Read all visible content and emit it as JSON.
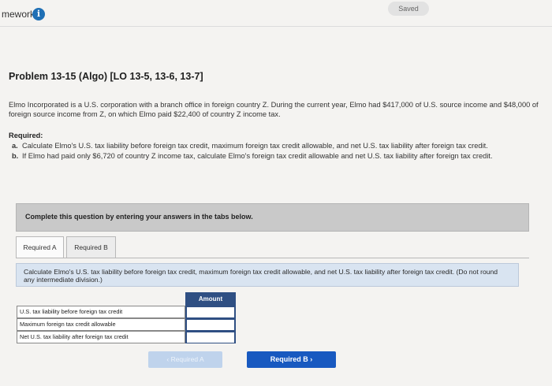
{
  "header": {
    "title": "mework",
    "info_icon": "info-icon",
    "saved_label": "Saved"
  },
  "problem": {
    "title": "Problem 13-15 (Algo) [LO 13-5, 13-6, 13-7]",
    "intro": "Elmo Incorporated is a U.S. corporation with a branch office in foreign country Z. During the current year, Elmo had $417,000 of U.S. source income and $48,000 of foreign source income from Z, on which Elmo paid $22,400 of country Z income tax.",
    "required_heading": "Required:",
    "requirements": [
      {
        "tag": "a.",
        "text": "Calculate Elmo's U.S. tax liability before foreign tax credit, maximum foreign tax credit allowable, and net U.S. tax liability after foreign tax credit."
      },
      {
        "tag": "b.",
        "text": "If Elmo had paid only $6,720 of country Z income tax, calculate Elmo's foreign tax credit allowable and net U.S. tax liability after foreign tax credit."
      }
    ]
  },
  "instruction": "Complete this question by entering your answers in the tabs below.",
  "tabs": [
    {
      "label": "Required A"
    },
    {
      "label": "Required B"
    }
  ],
  "question": "Calculate Elmo's U.S. tax liability before foreign tax credit, maximum foreign tax credit allowable, and net U.S. tax liability after foreign tax credit. (Do not round any intermediate division.)",
  "table": {
    "amount_header": "Amount",
    "rows": [
      {
        "label": "U.S. tax liability before foreign tax credit",
        "value": ""
      },
      {
        "label": "Maximum foreign tax credit allowable",
        "value": ""
      },
      {
        "label": "Net U.S. tax liability after foreign tax credit",
        "value": ""
      }
    ]
  },
  "nav": {
    "prev_label": "‹  Required A",
    "next_label": "Required B  ›"
  }
}
